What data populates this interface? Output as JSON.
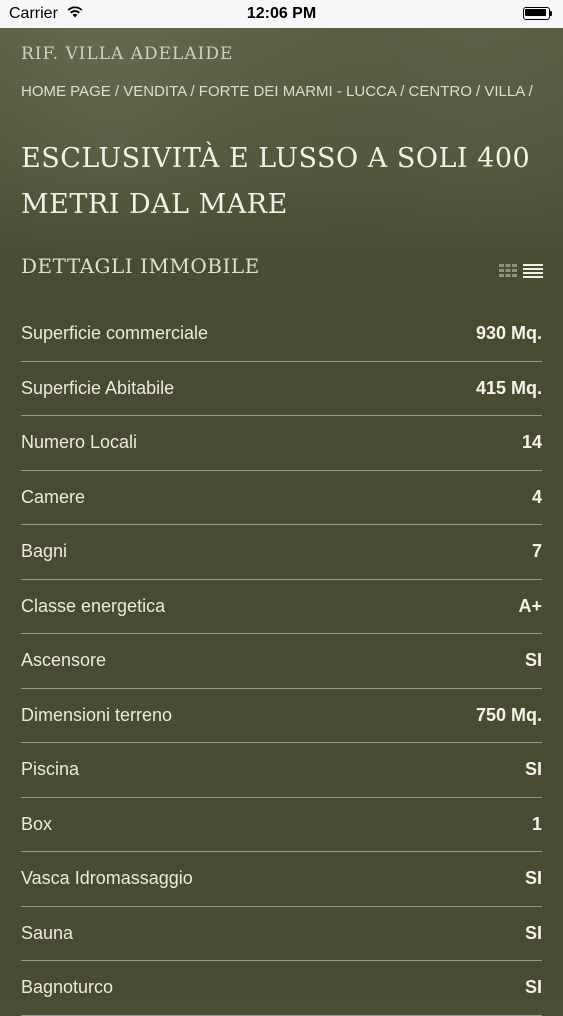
{
  "status_bar": {
    "carrier": "Carrier",
    "time": "12:06 PM"
  },
  "property": {
    "reference": "RIF. VILLA ADELAIDE",
    "breadcrumb": "HOME PAGE / VENDITA / FORTE DEI MARMI - LUCCA / CENTRO / VILLA /",
    "title": "ESCLUSIVITÀ E LUSSO A SOLI 400 METRI DAL MARE"
  },
  "details": {
    "section_title": "DETTAGLI IMMOBILE",
    "rows": [
      {
        "label": "Superficie commerciale",
        "value": "930 Mq."
      },
      {
        "label": "Superficie Abitabile",
        "value": "415 Mq."
      },
      {
        "label": "Numero Locali",
        "value": "14"
      },
      {
        "label": "Camere",
        "value": "4"
      },
      {
        "label": "Bagni",
        "value": "7"
      },
      {
        "label": "Classe energetica",
        "value": "A+"
      },
      {
        "label": "Ascensore",
        "value": "SI"
      },
      {
        "label": "Dimensioni terreno",
        "value": "750 Mq."
      },
      {
        "label": "Piscina",
        "value": "SI"
      },
      {
        "label": "Box",
        "value": "1"
      },
      {
        "label": "Vasca Idromassaggio",
        "value": "SI"
      },
      {
        "label": "Sauna",
        "value": "SI"
      },
      {
        "label": "Bagnoturco",
        "value": "SI"
      }
    ]
  },
  "icons": {
    "view_grid": "grid-view-icon",
    "view_list": "list-view-icon",
    "wifi": "wifi-icon",
    "battery": "battery-icon"
  }
}
